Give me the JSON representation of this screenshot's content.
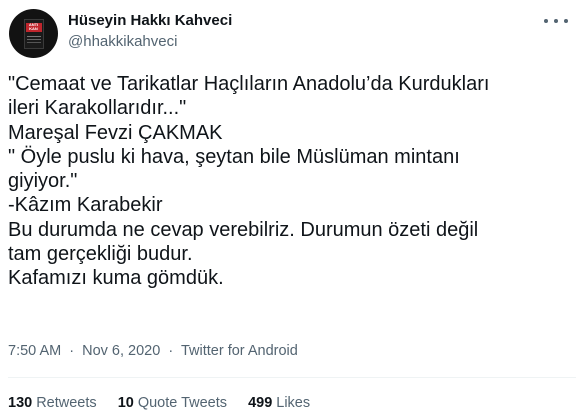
{
  "author": {
    "display_name": "Hüseyin Hakkı Kahveci",
    "handle": "@hhakkikahveci",
    "avatar_band_text": "ANTI KAN"
  },
  "tweet": {
    "lines": [
      "\"Cemaat ve Tarikatlar Haçlıların Anadolu’da Kurdukları",
      "ileri Karakollarıdır...\"",
      "Mareşal Fevzi ÇAKMAK",
      "\" Öyle puslu ki hava, şeytan bile Müslüman mintanı",
      "giyiyor.\"",
      "-Kâzım Karabekir",
      "Bu durumda ne cevap verebilriz. Durumun özeti değil",
      "tam gerçekliği budur.",
      "Kafamızı kuma gömdük."
    ]
  },
  "meta": {
    "time": "7:50 AM",
    "date": "Nov 6, 2020",
    "separator": "·",
    "source": "Twitter for Android"
  },
  "stats": {
    "retweets_count": "130",
    "retweets_label": "Retweets",
    "quotes_count": "10",
    "quotes_label": "Quote Tweets",
    "likes_count": "499",
    "likes_label": "Likes"
  },
  "icons": {
    "more": "more-horizontal-icon"
  }
}
